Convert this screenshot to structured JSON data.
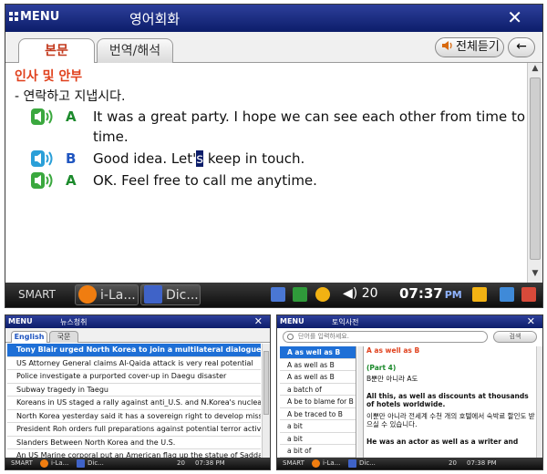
{
  "main": {
    "menu_label": "MENU",
    "title": "영어회화",
    "close_label": "✕",
    "tabs": [
      {
        "label": "본문"
      },
      {
        "label": "번역/해석"
      }
    ],
    "listen_all": "전체듣기",
    "back_label": "←",
    "heading": "인사 및 안부",
    "subheading": "- 연락하고 지냅시다.",
    "lines": [
      {
        "speaker": "A",
        "text": "It was a great party. I hope we can see each other from time to",
        "text2": "time."
      },
      {
        "speaker": "B",
        "text_before": "Good idea. Let'",
        "text_selected": "s",
        "text_after": " keep in touch."
      },
      {
        "speaker": "A",
        "text": "OK. Feel free to call me anytime."
      }
    ],
    "taskbar": {
      "start": "SMART",
      "apps": [
        {
          "label": "i-La..."
        },
        {
          "label": "Dic..."
        }
      ],
      "volume": "20",
      "time": "07:37",
      "ampm": "PM"
    },
    "colors": {
      "title_bar": "#0c1d6a",
      "heading": "#e0401c",
      "speaker_a": "#1c8a2c",
      "speaker_b": "#1f55c0"
    }
  },
  "news": {
    "menu_label": "MENU",
    "title": "뉴스청취",
    "tabs": [
      {
        "label": "English"
      },
      {
        "label": "국문"
      }
    ],
    "items": [
      "Tony Blair urged North Korea to join a multilateral dialogue.",
      "US Attorney General claims Al-Qaida attack is very real potential",
      "Police investigate a purported cover-up in Daegu disaster",
      "Subway tragedy in Taegu",
      "Koreans in US staged a rally against anti_U.S. and N.Korea's nuclear",
      "North Korea yesterday said it has a sovereign right to develop missiles",
      "President Roh orders full preparations against potential terror activities",
      "Slanders Between North Korea and the U.S.",
      "An US Marine corporal put an American flag up the statue of Saddam Hussein"
    ],
    "taskbar": {
      "start": "SMART",
      "app1": "i-La...",
      "app2": "Dic...",
      "volume": "20",
      "time": "07:38 PM"
    }
  },
  "dict": {
    "menu_label": "MENU",
    "title": "토익사전",
    "search_placeholder": "단어를 입력하세요.",
    "search_button": "검색",
    "words": [
      "A as well as B",
      "A as well as B",
      "A as well as B",
      "a batch of",
      "A be to blame for B",
      "A be traced to B",
      "a bit",
      "a bit",
      "a bit of"
    ],
    "detail": {
      "word": "A as well as B",
      "part": "(Part 4)",
      "meaning": "B뿐만 아니라 A도",
      "example1_en": "All this, as well as discounts at thousands of hotels worldwide.",
      "example1_ko": "이뿐만 아니라 전세계 수천 개의 호텔에서 숙박료 할인도 받으실 수 있습니다.",
      "example2_en": "He was an actor as well as a writer and"
    },
    "taskbar": {
      "start": "SMART",
      "app1": "i-La...",
      "app2": "Dic...",
      "volume": "20",
      "time": "07:38 PM"
    }
  }
}
